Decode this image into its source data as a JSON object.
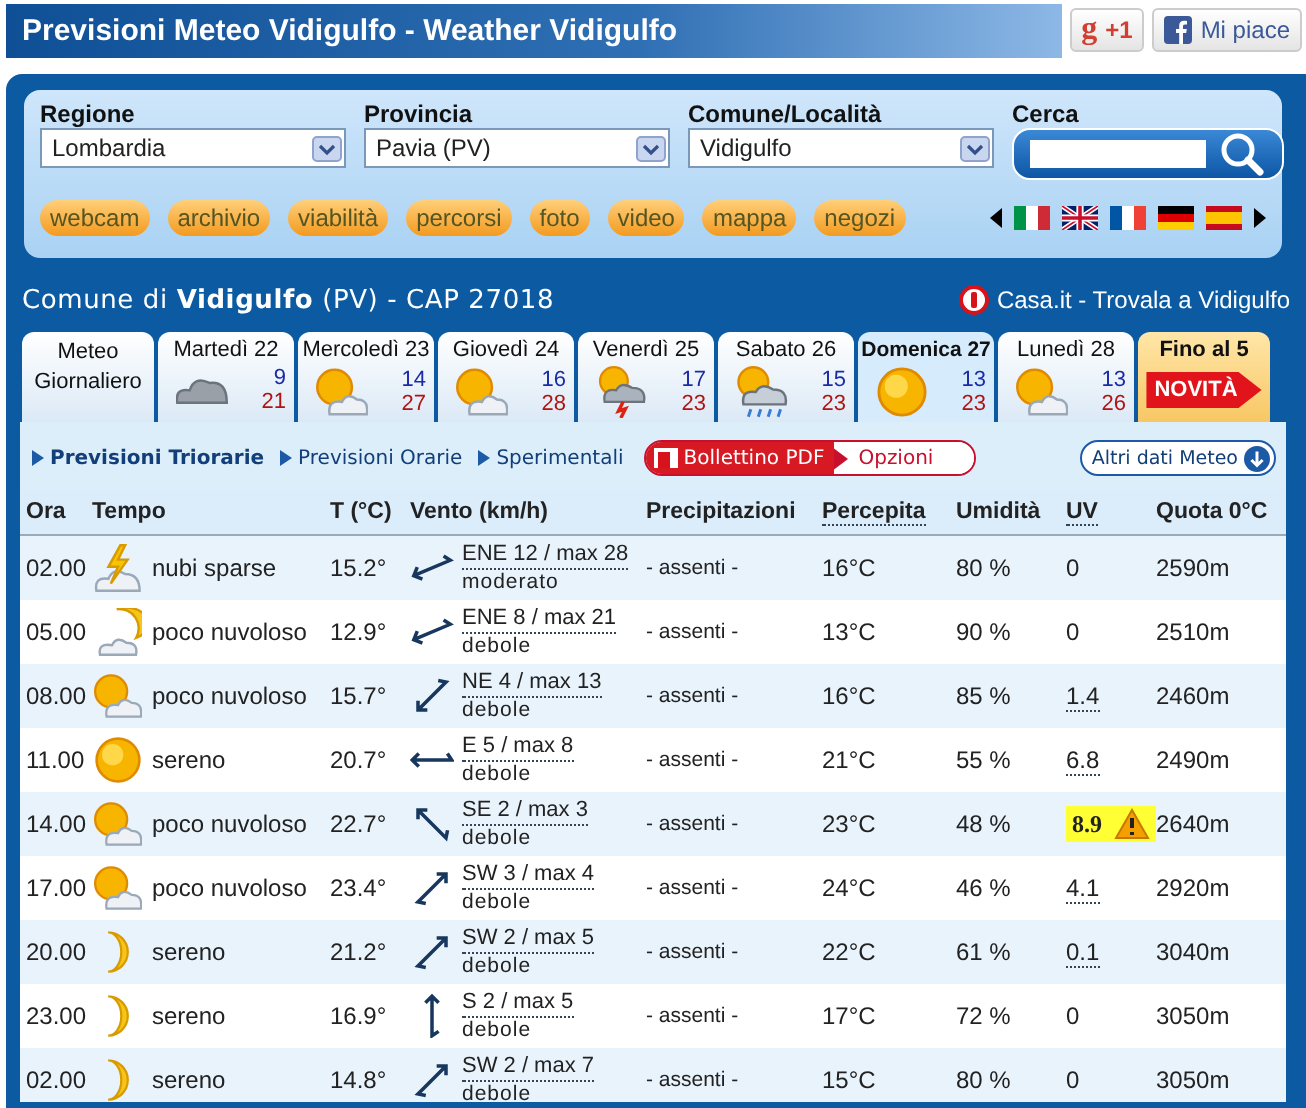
{
  "header": {
    "title": "Previsioni Meteo Vidigulfo - Weather Vidigulfo",
    "gplus": {
      "logo": "g",
      "label": "+1"
    },
    "facebook": {
      "label": "Mi piace"
    }
  },
  "search_panel": {
    "selects": [
      {
        "label": "Regione",
        "value": "Lombardia"
      },
      {
        "label": "Provincia",
        "value": "Pavia (PV)"
      },
      {
        "label": "Comune/Località",
        "value": "Vidigulfo"
      }
    ],
    "search": {
      "label": "Cerca"
    },
    "links": [
      "webcam",
      "archivio",
      "viabilità",
      "percorsi",
      "foto",
      "video",
      "mappa",
      "negozi"
    ]
  },
  "location": {
    "prefix": "Comune di",
    "name": "Vidigulfo",
    "suffix": "(PV) - CAP 27018",
    "casa_link": "Casa.it - Trovala a Vidigulfo"
  },
  "tabs": [
    {
      "kind": "daily",
      "label": "Meteo",
      "label2": "Giornaliero",
      "selected": false
    },
    {
      "kind": "cloud",
      "label": "Martedì 22",
      "min": "9",
      "max": "21",
      "selected": false
    },
    {
      "kind": "sun-cloud",
      "label": "Mercoledì 23",
      "min": "14",
      "max": "27",
      "selected": false
    },
    {
      "kind": "sun-cloud",
      "label": "Giovedì 24",
      "min": "16",
      "max": "28",
      "selected": false
    },
    {
      "kind": "sun-storm",
      "label": "Venerdì 25",
      "min": "17",
      "max": "23",
      "selected": false
    },
    {
      "kind": "sun-rain",
      "label": "Sabato 26",
      "min": "15",
      "max": "23",
      "selected": false
    },
    {
      "kind": "sun",
      "label": "Domenica 27",
      "min": "13",
      "max": "23",
      "selected": true
    },
    {
      "kind": "sun-cloud",
      "label": "Lunedì 28",
      "min": "13",
      "max": "26",
      "selected": false
    },
    {
      "kind": "more",
      "label": "Fino al 5",
      "badge": "NOVITÀ",
      "selected": false
    }
  ],
  "subnav": {
    "links": [
      {
        "label": "Previsioni Triorarie",
        "selected": true
      },
      {
        "label": "Previsioni Orarie",
        "selected": false
      },
      {
        "label": "Sperimentali",
        "selected": false
      }
    ],
    "pdf_button": "Bollettino PDF",
    "options_button": "Opzioni",
    "more_button": "Altri dati Meteo"
  },
  "table": {
    "columns": [
      "Ora",
      "Tempo",
      "T (°C)",
      "Vento (km/h)",
      "Precipitazioni",
      "Percepita",
      "Umidità",
      "UV",
      "Quota 0°C"
    ],
    "rows": [
      {
        "kind": "lightning-cloud",
        "time": "02.00",
        "sky": "nubi sparse",
        "temp": "15.2°",
        "wind": {
          "kind": "from-ene",
          "text": "ENE 12 / max 28",
          "strength": "moderato"
        },
        "rain": "- assenti -",
        "feel": "16°C",
        "humidity": "80 %",
        "uv": "0",
        "uv_hint": false,
        "uv_warning": false,
        "freezing": "2590m"
      },
      {
        "kind": "moon-cloud",
        "time": "05.00",
        "sky": "poco nuvoloso",
        "temp": "12.9°",
        "wind": {
          "kind": "from-ene",
          "text": "ENE 8 / max 21",
          "strength": "debole"
        },
        "rain": "- assenti -",
        "feel": "13°C",
        "humidity": "90 %",
        "uv": "0",
        "uv_hint": false,
        "uv_warning": false,
        "freezing": "2510m"
      },
      {
        "kind": "sun-cloud",
        "time": "08.00",
        "sky": "poco nuvoloso",
        "temp": "15.7°",
        "wind": {
          "kind": "from-ne",
          "text": "NE 4 / max 13",
          "strength": "debole"
        },
        "rain": "- assenti -",
        "feel": "16°C",
        "humidity": "85 %",
        "uv": "1.4",
        "uv_hint": true,
        "uv_warning": false,
        "freezing": "2460m"
      },
      {
        "kind": "sun",
        "time": "11.00",
        "sky": "sereno",
        "temp": "20.7°",
        "wind": {
          "kind": "from-e",
          "text": "E 5 / max 8",
          "strength": "debole"
        },
        "rain": "- assenti -",
        "feel": "21°C",
        "humidity": "55 %",
        "uv": "6.8",
        "uv_hint": true,
        "uv_warning": false,
        "freezing": "2490m"
      },
      {
        "kind": "sun-cloud",
        "time": "14.00",
        "sky": "poco nuvoloso",
        "temp": "22.7°",
        "wind": {
          "kind": "from-se",
          "text": "SE 2 / max 3",
          "strength": "debole"
        },
        "rain": "- assenti -",
        "feel": "23°C",
        "humidity": "48 %",
        "uv": "8.9",
        "uv_hint": false,
        "uv_warning": true,
        "freezing": "2640m"
      },
      {
        "kind": "sun-cloud",
        "time": "17.00",
        "sky": "poco nuvoloso",
        "temp": "23.4°",
        "wind": {
          "kind": "from-sw",
          "text": "SW 3 / max 4",
          "strength": "debole"
        },
        "rain": "- assenti -",
        "feel": "24°C",
        "humidity": "46 %",
        "uv": "4.1",
        "uv_hint": true,
        "uv_warning": false,
        "freezing": "2920m"
      },
      {
        "kind": "moon",
        "time": "20.00",
        "sky": "sereno",
        "temp": "21.2°",
        "wind": {
          "kind": "from-sw",
          "text": "SW 2 / max 5",
          "strength": "debole"
        },
        "rain": "- assenti -",
        "feel": "22°C",
        "humidity": "61 %",
        "uv": "0.1",
        "uv_hint": true,
        "uv_warning": false,
        "freezing": "3040m"
      },
      {
        "kind": "moon",
        "time": "23.00",
        "sky": "sereno",
        "temp": "16.9°",
        "wind": {
          "kind": "from-s",
          "text": "S 2 / max 5",
          "strength": "debole"
        },
        "rain": "- assenti -",
        "feel": "17°C",
        "humidity": "72 %",
        "uv": "0",
        "uv_hint": false,
        "uv_warning": false,
        "freezing": "3050m"
      },
      {
        "kind": "moon",
        "time": "02.00",
        "sky": "sereno",
        "temp": "14.8°",
        "wind": {
          "kind": "from-sw",
          "text": "SW 2 / max 7",
          "strength": "debole"
        },
        "rain": "- assenti -",
        "feel": "15°C",
        "humidity": "80 %",
        "uv": "0",
        "uv_hint": false,
        "uv_warning": false,
        "freezing": "3050m"
      }
    ]
  }
}
